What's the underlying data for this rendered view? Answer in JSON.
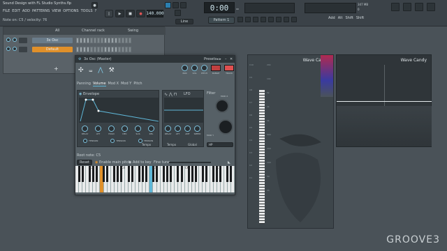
{
  "title": "Sound Design with FL Studio Synths.flp",
  "menu": [
    "FILE",
    "EDIT",
    "ADD",
    "PATTERNS",
    "VIEW",
    "OPTIONS",
    "TOOLS",
    "?"
  ],
  "hint": "Note on: C5 / velocity: 76",
  "transport": {
    "tempo": "140.000",
    "time": "0:00",
    "time_small": "00",
    "cpu": "347 MB",
    "cpu2": "0"
  },
  "pattern": "Pattern 1",
  "snap": "Line",
  "tools": [
    "Add",
    "Alt",
    "Shift",
    "Shift"
  ],
  "rack": {
    "title": "Channel rack",
    "filter": "All",
    "swing": "Swing",
    "channels": [
      {
        "name": "3x Osc",
        "color": "#6a7c8a"
      },
      {
        "name": "Default",
        "color": "#e0902a"
      }
    ]
  },
  "plugin": {
    "title": "3x Osc (Master)",
    "presets_label": "Presets",
    "tabs": [
      "Panning",
      "Volume",
      "Mod X",
      "Mod Y",
      "Pitch"
    ],
    "active_tab": "Volume",
    "head_knobs": [
      "PAN",
      "VOL",
      "PITCH",
      "RANGE"
    ],
    "track_label": "TRACK",
    "envelope_label": "Envelope",
    "env_knobs": [
      "DELAY",
      "ATT",
      "HOLD",
      "DEC",
      "SUS",
      "REL"
    ],
    "tension": [
      "TENSION",
      "TENSION",
      "TENSION"
    ],
    "tempo_label": "Tempo",
    "lfo_label": "LFO",
    "lfo_knobs": [
      "DELAY",
      "ATT",
      "AMT",
      "SPEED"
    ],
    "lfo_tempo": "Tempo",
    "lfo_global": "Global",
    "filter_label": "Filter",
    "modx": "MOD X",
    "mody": "MOD Y",
    "filter_type": "HP",
    "root_note": "Root note: C5",
    "reset": "Reset",
    "enable_pitch": "Enable main pitch",
    "add_key": "Add to key",
    "fine_tune": "Fine tune",
    "octaves": [
      "C3",
      "C4",
      "C5",
      "C6",
      "C7"
    ]
  },
  "wave1": {
    "title": "Wave Candy",
    "notes": [
      "C10",
      "C9",
      "C8",
      "C7",
      "C6",
      "C5",
      "C4",
      "C3",
      "C2",
      "C1"
    ],
    "freqs": [
      "20k",
      "10k",
      "5k",
      "2k",
      "1k",
      "500",
      "200",
      "100",
      "50",
      "20"
    ]
  },
  "wave2": {
    "title": "Wave Candy"
  },
  "logo": "GROOVE3",
  "colors": {
    "accent": "#5fb7d8",
    "orange": "#e0902a"
  }
}
